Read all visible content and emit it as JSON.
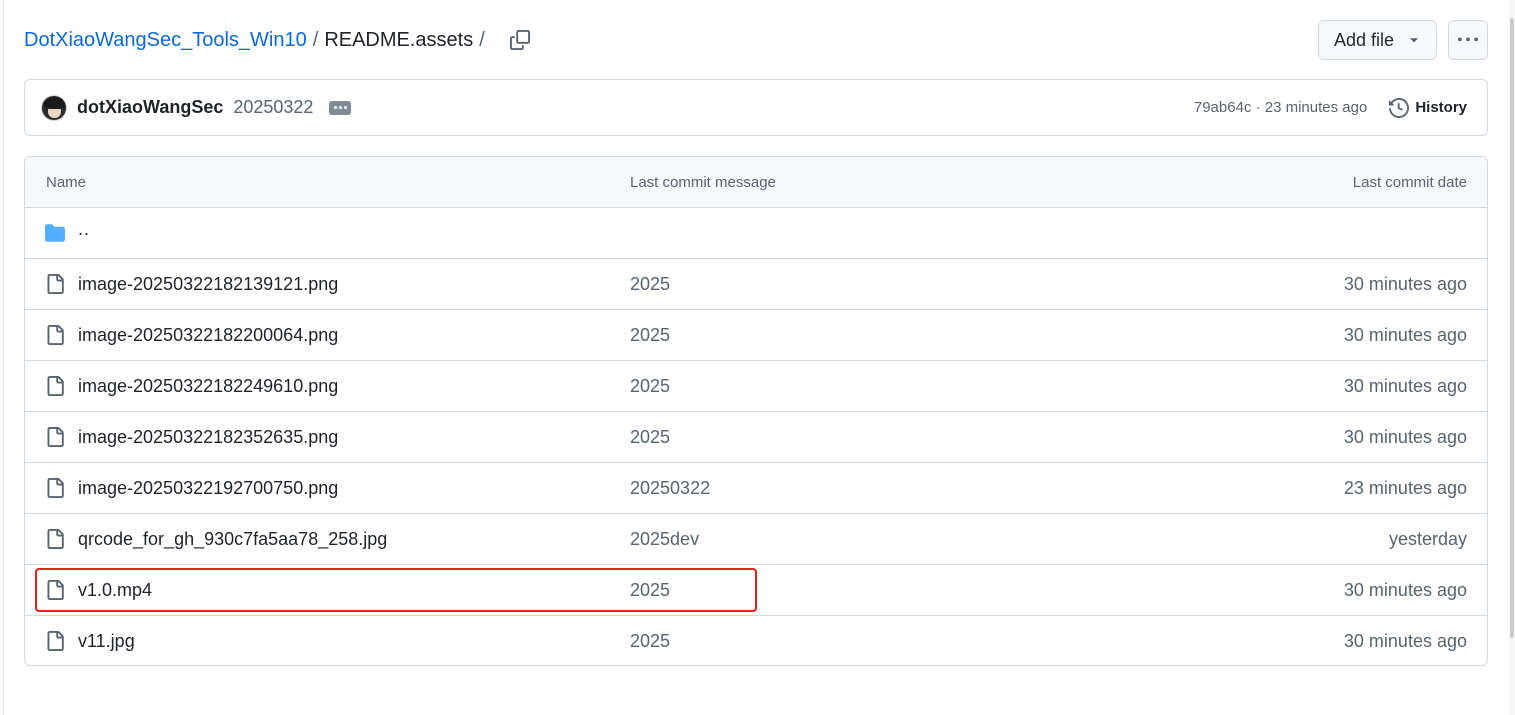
{
  "breadcrumb": {
    "repo": "DotXiaoWangSec_Tools_Win10",
    "separator": "/",
    "current": "README.assets",
    "trailing": "/"
  },
  "header": {
    "add_file_label": "Add file"
  },
  "commit": {
    "author": "dotXiaoWangSec",
    "message": "20250322",
    "hash_time": "79ab64c · 23 minutes ago",
    "history_label": "History"
  },
  "table": {
    "headers": {
      "name": "Name",
      "message": "Last commit message",
      "date": "Last commit date"
    },
    "parent_dir": "..",
    "rows": [
      {
        "name": "image-20250322182139121.png",
        "message": "2025",
        "date": "30 minutes ago"
      },
      {
        "name": "image-20250322182200064.png",
        "message": "2025",
        "date": "30 minutes ago"
      },
      {
        "name": "image-20250322182249610.png",
        "message": "2025",
        "date": "30 minutes ago"
      },
      {
        "name": "image-20250322182352635.png",
        "message": "2025",
        "date": "30 minutes ago"
      },
      {
        "name": "image-20250322192700750.png",
        "message": "20250322",
        "date": "23 minutes ago"
      },
      {
        "name": "qrcode_for_gh_930c7fa5aa78_258.jpg",
        "message": "2025dev",
        "date": "yesterday"
      },
      {
        "name": "v1.0.mp4",
        "message": "2025",
        "date": "30 minutes ago"
      },
      {
        "name": "v11.jpg",
        "message": "2025",
        "date": "30 minutes ago"
      }
    ]
  },
  "icons": {
    "copy": "copy-icon",
    "caret": "triangle-down-icon",
    "kebab": "kebab-horizontal-icon",
    "history": "history-icon",
    "folder": "folder-icon",
    "file": "file-icon"
  },
  "colors": {
    "link": "#0969da",
    "folder": "#54aeff",
    "highlight": "#e8201a",
    "border": "#d1d9e0",
    "muted": "#59636e"
  }
}
